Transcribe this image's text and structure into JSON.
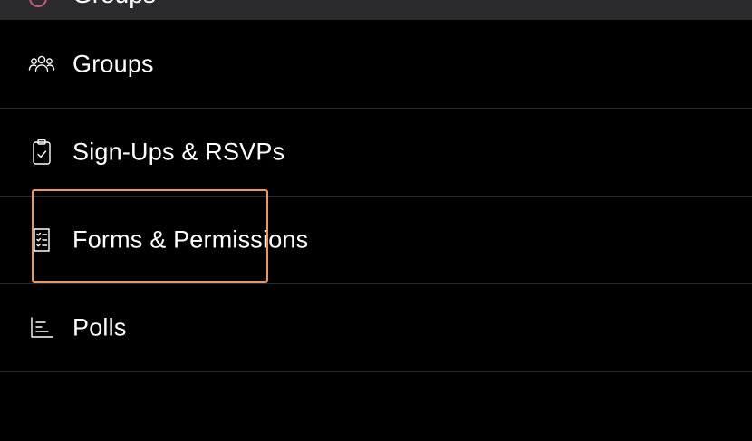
{
  "header": {
    "title": "Groups"
  },
  "menu": {
    "items": [
      {
        "label": "Groups",
        "icon": "groups-icon"
      },
      {
        "label": "Sign-Ups & RSVPs",
        "icon": "clipboard-check-icon"
      },
      {
        "label": "Forms & Permissions",
        "icon": "form-checklist-icon"
      },
      {
        "label": "Polls",
        "icon": "bar-chart-icon"
      }
    ]
  },
  "colors": {
    "background": "#000000",
    "top_bar": "#2b2b2d",
    "divider": "#2a2a2c",
    "text": "#ffffff",
    "highlight": "#f0965a",
    "avatar_ring": "#c2587a"
  }
}
